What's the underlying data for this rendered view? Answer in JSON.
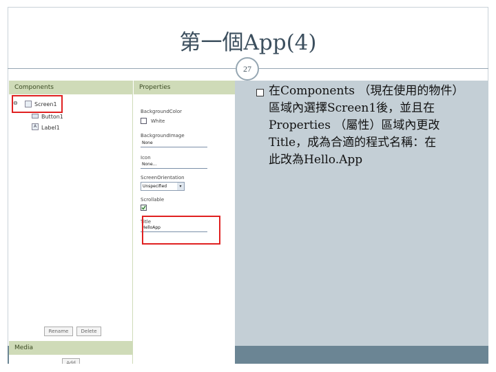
{
  "slide": {
    "title": "第一個App(4)",
    "page_number": "27",
    "bullet": "在Components （現在使用的物件）\n區域內選擇Screen1後，並且在\nProperties （屬性）區域內更改\nTitle，成為合適的程式名稱：在\n此改為Hello.App"
  },
  "screenshot": {
    "components_header": "Components",
    "properties_header": "Properties",
    "media_header": "Media",
    "tree": {
      "collapse_symbol": "⊖",
      "screen": "Screen1",
      "button": "Button1",
      "label": "Label1",
      "label_icon_glyph": "A"
    },
    "properties": {
      "bg_color_label": "BackgroundColor",
      "bg_color_value": "White",
      "bg_image_label": "BackgroundImage",
      "bg_image_value": "None",
      "icon_label": "Icon",
      "icon_value": "None...",
      "orientation_label": "ScreenOrientation",
      "orientation_value": "Unspecified",
      "scrollable_label": "Scrollable",
      "title_label": "Title",
      "title_value": "HelloApp"
    },
    "buttons": {
      "rename": "Rename",
      "delete": "Delete",
      "add": "Add"
    },
    "colors": {
      "header_bg": "#cfdbb8",
      "highlight": "#e02020",
      "panel_bg": "#c4cfd6",
      "band": "#6b8594"
    }
  }
}
